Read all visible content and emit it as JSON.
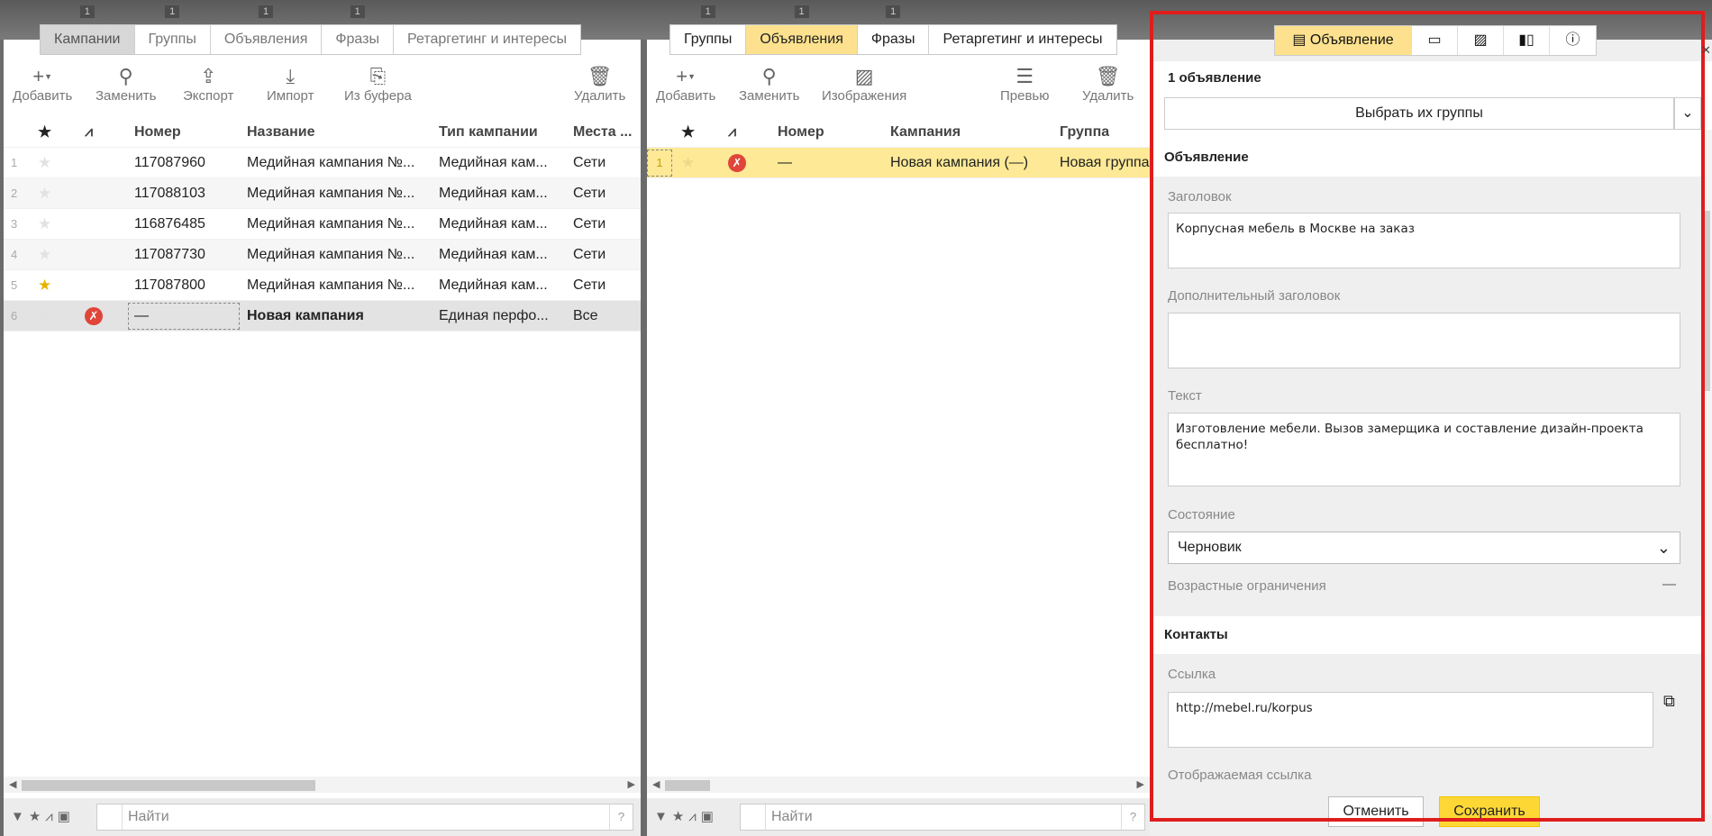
{
  "campaigns_panel": {
    "tabs": [
      {
        "label": "Кампании",
        "badge": "1"
      },
      {
        "label": "Группы",
        "badge": "1"
      },
      {
        "label": "Объявления",
        "badge": "1"
      },
      {
        "label": "Фразы",
        "badge": "1"
      },
      {
        "label": "Ретаргетинг и интересы",
        "badge": ""
      }
    ],
    "toolbar": {
      "add": "Добавить",
      "replace": "Заменить",
      "export": "Экспорт",
      "import": "Импорт",
      "from_buffer": "Из буфера",
      "delete": "Удалить"
    },
    "columns": [
      "★",
      "⩘",
      "Номер",
      "Название",
      "Тип кампании",
      "Места ..."
    ],
    "rows": [
      {
        "n": "1",
        "number": "117087960",
        "name": "Медийная кампания №...",
        "type": "Медийная кам...",
        "places": "Сети",
        "starred": false
      },
      {
        "n": "2",
        "number": "117088103",
        "name": "Медийная кампания №...",
        "type": "Медийная кам...",
        "places": "Сети",
        "starred": false
      },
      {
        "n": "3",
        "number": "116876485",
        "name": "Медийная кампания №...",
        "type": "Медийная кам...",
        "places": "Сети",
        "starred": false
      },
      {
        "n": "4",
        "number": "117087730",
        "name": "Медийная кампания №...",
        "type": "Медийная кам...",
        "places": "Сети",
        "starred": false
      },
      {
        "n": "5",
        "number": "117087800",
        "name": "Медийная кампания №...",
        "type": "Медийная кам...",
        "places": "Сети",
        "starred": true
      },
      {
        "n": "6",
        "number": "—",
        "name": "Новая кампания",
        "type": "Единая перфо...",
        "places": "Все",
        "starred": false
      }
    ],
    "search_placeholder": "Найти",
    "help": "?"
  },
  "ads_panel": {
    "tabs": [
      {
        "label": "Группы",
        "badge": "1"
      },
      {
        "label": "Объявления",
        "badge": "1"
      },
      {
        "label": "Фразы",
        "badge": "1"
      },
      {
        "label": "Ретаргетинг и интересы",
        "badge": ""
      }
    ],
    "toolbar": {
      "add": "Добавить",
      "replace": "Заменить",
      "images": "Изображения",
      "preview": "Превью",
      "delete": "Удалить"
    },
    "columns": [
      "★",
      "⩘",
      "Номер",
      "Кампания",
      "Группа"
    ],
    "rows": [
      {
        "n": "1",
        "number": "—",
        "campaign": "Новая кампания (—)",
        "group": "Новая группа"
      }
    ],
    "search_placeholder": "Найти",
    "help": "?"
  },
  "editor": {
    "tab_ad_label": "Объявление",
    "count_label": "1 объявление",
    "choose_groups": "Выбрать их группы",
    "section_ad": "Объявление",
    "title_label": "Заголовок",
    "title_value": "Корпусная мебель в Москве на заказ",
    "subtitle_label": "Дополнительный заголовок",
    "subtitle_value": "",
    "text_label": "Текст",
    "text_value": "Изготовление мебели. Вызов замерщика и составление дизайн-проекта бесплатно!",
    "status_label": "Состояние",
    "status_value": "Черновик",
    "age_label": "Возрастные ограничения",
    "age_value": "—",
    "section_contacts": "Контакты",
    "link_label": "Ссылка",
    "link_value": "http://mebel.ru/korpus",
    "display_link_label": "Отображаемая ссылка",
    "cancel": "Отменить",
    "save": "Сохранить"
  },
  "colors": {
    "accent_yellow": "#fde18e",
    "save_yellow": "#fdd835",
    "highlight_red": "#e01d1d"
  }
}
